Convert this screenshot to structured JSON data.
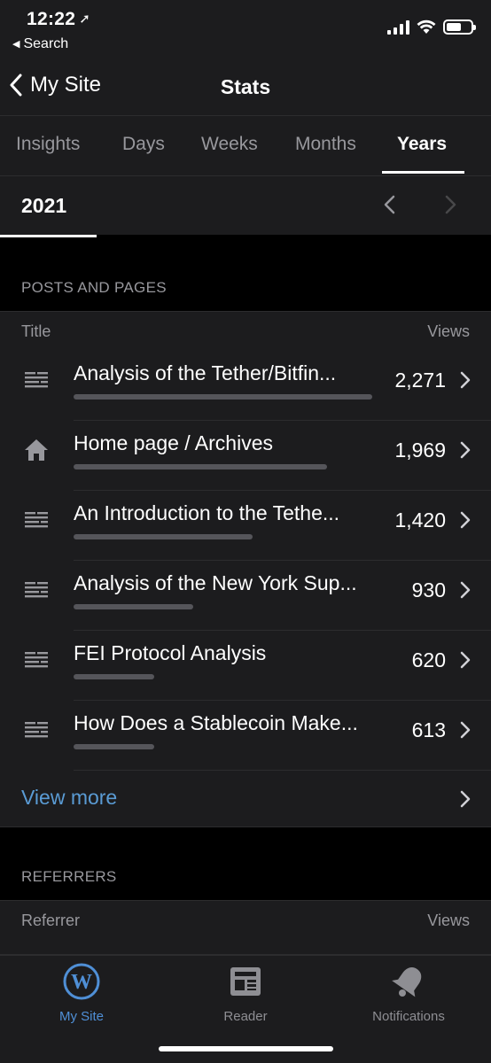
{
  "status": {
    "time": "12:22",
    "back_label": "Search"
  },
  "nav": {
    "back_label": "My Site",
    "title": "Stats"
  },
  "tabs": [
    {
      "label": "Insights",
      "active": false
    },
    {
      "label": "Days",
      "active": false
    },
    {
      "label": "Weeks",
      "active": false
    },
    {
      "label": "Months",
      "active": false
    },
    {
      "label": "Years",
      "active": true
    }
  ],
  "period": {
    "label": "2021"
  },
  "posts": {
    "header": "POSTS AND PAGES",
    "col_title": "Title",
    "col_views": "Views",
    "rows": [
      {
        "icon": "document-icon",
        "title": "Analysis of the Tether/Bitfin...",
        "views": "2,271",
        "fraction": 1.0
      },
      {
        "icon": "home-icon",
        "title": "Home page / Archives",
        "views": "1,969",
        "fraction": 0.85
      },
      {
        "icon": "document-icon",
        "title": "An Introduction to the Tethe...",
        "views": "1,420",
        "fraction": 0.6
      },
      {
        "icon": "document-icon",
        "title": "Analysis of the New York Sup...",
        "views": "930",
        "fraction": 0.4
      },
      {
        "icon": "document-icon",
        "title": "FEI Protocol Analysis",
        "views": "620",
        "fraction": 0.27
      },
      {
        "icon": "document-icon",
        "title": "How Does a Stablecoin Make...",
        "views": "613",
        "fraction": 0.27
      }
    ],
    "view_more": "View more"
  },
  "referrers": {
    "header": "REFERRERS",
    "col_title": "Referrer",
    "col_views": "Views"
  },
  "tabbar": {
    "items": [
      {
        "label": "My Site",
        "icon": "wordpress-icon",
        "active": true
      },
      {
        "label": "Reader",
        "icon": "reader-icon",
        "active": false
      },
      {
        "label": "Notifications",
        "icon": "bell-icon",
        "active": false
      }
    ]
  },
  "colors": {
    "accent": "#4f8fd6",
    "link": "#5a9bd4",
    "background": "#000000",
    "surface": "#1c1c1e"
  }
}
